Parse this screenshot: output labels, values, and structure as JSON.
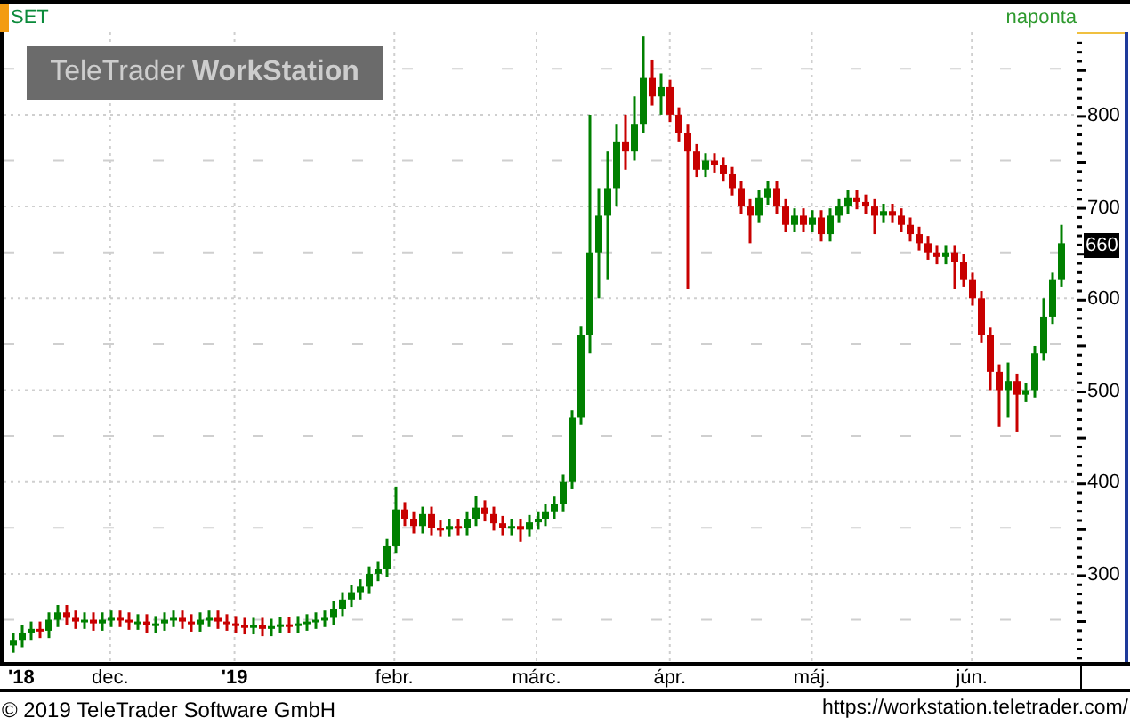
{
  "header": {
    "symbol": "SET",
    "interval": "naponta"
  },
  "logo": {
    "text_1": "TeleTrader",
    "text_2": "WorkStation"
  },
  "price_axis": {
    "current_price": "660"
  },
  "chart": {
    "chart_data": {
      "type": "candlestick",
      "grid": true,
      "ylim": [
        204,
        890
      ],
      "yticks": [
        300,
        400,
        500,
        600,
        700,
        800
      ],
      "categories": [
        null,
        "'18",
        null,
        null,
        null,
        null,
        null,
        null,
        null,
        null,
        null,
        "dec.",
        null,
        null,
        null,
        null,
        null,
        null,
        null,
        null,
        null,
        null,
        null,
        null,
        null,
        "'19",
        null,
        null,
        null,
        null,
        null,
        null,
        null,
        null,
        null,
        null,
        null,
        null,
        null,
        null,
        null,
        null,
        null,
        "febr.",
        null,
        null,
        null,
        null,
        null,
        null,
        null,
        null,
        null,
        null,
        null,
        null,
        null,
        null,
        null,
        "márc.",
        null,
        null,
        null,
        null,
        null,
        null,
        null,
        null,
        null,
        null,
        null,
        null,
        null,
        null,
        "ápr.",
        null,
        null,
        null,
        null,
        null,
        null,
        null,
        null,
        null,
        null,
        null,
        null,
        null,
        null,
        null,
        "máj.",
        null,
        null,
        null,
        null,
        null,
        null,
        null,
        null,
        null,
        null,
        null,
        null,
        null,
        null,
        null,
        null,
        null,
        "jún.",
        null,
        null,
        null,
        null,
        null,
        null,
        null,
        null,
        null,
        null
      ],
      "ohlc": [
        [
          222,
          236,
          214,
          228
        ],
        [
          228,
          244,
          220,
          236
        ],
        [
          236,
          248,
          228,
          240
        ],
        [
          240,
          248,
          230,
          238
        ],
        [
          238,
          258,
          230,
          250
        ],
        [
          250,
          266,
          242,
          258
        ],
        [
          258,
          266,
          244,
          252
        ],
        [
          252,
          260,
          240,
          248
        ],
        [
          248,
          258,
          240,
          250
        ],
        [
          250,
          258,
          238,
          246
        ],
        [
          246,
          258,
          238,
          250
        ],
        [
          250,
          260,
          242,
          252
        ],
        [
          252,
          260,
          242,
          250
        ],
        [
          250,
          258,
          239,
          247
        ],
        [
          247,
          256,
          239,
          248
        ],
        [
          248,
          256,
          236,
          244
        ],
        [
          244,
          254,
          236,
          246
        ],
        [
          246,
          258,
          238,
          250
        ],
        [
          250,
          260,
          242,
          252
        ],
        [
          252,
          260,
          240,
          248
        ],
        [
          248,
          256,
          237,
          245
        ],
        [
          245,
          258,
          237,
          250
        ],
        [
          250,
          260,
          242,
          252
        ],
        [
          252,
          260,
          240,
          248
        ],
        [
          248,
          256,
          238,
          246
        ],
        [
          246,
          254,
          236,
          244
        ],
        [
          244,
          252,
          234,
          242
        ],
        [
          242,
          252,
          234,
          244
        ],
        [
          244,
          252,
          232,
          240
        ],
        [
          240,
          251,
          232,
          243
        ],
        [
          243,
          253,
          235,
          245
        ],
        [
          245,
          253,
          236,
          244
        ],
        [
          244,
          254,
          236,
          246
        ],
        [
          246,
          256,
          238,
          248
        ],
        [
          248,
          258,
          240,
          250
        ],
        [
          250,
          260,
          242,
          252
        ],
        [
          252,
          270,
          244,
          262
        ],
        [
          262,
          280,
          254,
          272
        ],
        [
          272,
          288,
          264,
          280
        ],
        [
          280,
          294,
          272,
          286
        ],
        [
          286,
          308,
          278,
          300
        ],
        [
          300,
          313,
          292,
          305
        ],
        [
          305,
          338,
          297,
          330
        ],
        [
          330,
          395,
          322,
          370
        ],
        [
          370,
          378,
          352,
          360
        ],
        [
          360,
          368,
          344,
          352
        ],
        [
          352,
          373,
          344,
          365
        ],
        [
          365,
          373,
          342,
          350
        ],
        [
          350,
          358,
          340,
          348
        ],
        [
          348,
          360,
          340,
          352
        ],
        [
          352,
          360,
          342,
          350
        ],
        [
          350,
          368,
          342,
          360
        ],
        [
          360,
          385,
          352,
          372
        ],
        [
          372,
          380,
          357,
          365
        ],
        [
          365,
          373,
          347,
          355
        ],
        [
          355,
          363,
          342,
          350
        ],
        [
          350,
          360,
          342,
          352
        ],
        [
          352,
          360,
          335,
          348
        ],
        [
          348,
          364,
          340,
          356
        ],
        [
          356,
          368,
          348,
          360
        ],
        [
          360,
          376,
          352,
          368
        ],
        [
          368,
          384,
          360,
          376
        ],
        [
          376,
          408,
          368,
          400
        ],
        [
          400,
          478,
          392,
          470
        ],
        [
          470,
          570,
          462,
          560
        ],
        [
          560,
          800,
          540,
          650
        ],
        [
          650,
          720,
          600,
          690
        ],
        [
          690,
          760,
          620,
          720
        ],
        [
          720,
          790,
          700,
          770
        ],
        [
          770,
          800,
          740,
          760
        ],
        [
          760,
          820,
          750,
          790
        ],
        [
          790,
          885,
          780,
          840
        ],
        [
          840,
          860,
          810,
          820
        ],
        [
          820,
          845,
          800,
          830
        ],
        [
          830,
          838,
          792,
          800
        ],
        [
          800,
          808,
          770,
          780
        ],
        [
          780,
          790,
          610,
          760
        ],
        [
          760,
          768,
          732,
          740
        ],
        [
          740,
          758,
          732,
          750
        ],
        [
          750,
          758,
          737,
          745
        ],
        [
          745,
          753,
          727,
          735
        ],
        [
          735,
          743,
          712,
          720
        ],
        [
          720,
          728,
          692,
          700
        ],
        [
          700,
          708,
          660,
          690
        ],
        [
          690,
          718,
          682,
          710
        ],
        [
          710,
          728,
          702,
          720
        ],
        [
          720,
          728,
          692,
          700
        ],
        [
          700,
          708,
          672,
          680
        ],
        [
          680,
          698,
          672,
          690
        ],
        [
          690,
          698,
          672,
          680
        ],
        [
          680,
          696,
          672,
          688
        ],
        [
          688,
          696,
          662,
          670
        ],
        [
          670,
          698,
          662,
          690
        ],
        [
          690,
          708,
          682,
          700
        ],
        [
          700,
          718,
          692,
          710
        ],
        [
          710,
          718,
          697,
          705
        ],
        [
          705,
          713,
          692,
          700
        ],
        [
          700,
          708,
          670,
          690
        ],
        [
          690,
          703,
          682,
          695
        ],
        [
          695,
          703,
          682,
          690
        ],
        [
          690,
          698,
          672,
          680
        ],
        [
          680,
          688,
          662,
          670
        ],
        [
          670,
          678,
          652,
          660
        ],
        [
          660,
          668,
          642,
          650
        ],
        [
          650,
          658,
          637,
          645
        ],
        [
          645,
          658,
          637,
          650
        ],
        [
          650,
          658,
          610,
          640
        ],
        [
          640,
          648,
          612,
          620
        ],
        [
          620,
          628,
          592,
          600
        ],
        [
          600,
          608,
          552,
          560
        ],
        [
          560,
          568,
          500,
          520
        ],
        [
          520,
          528,
          460,
          500
        ],
        [
          500,
          530,
          470,
          510
        ],
        [
          510,
          518,
          455,
          495
        ],
        [
          495,
          508,
          487,
          500
        ],
        [
          500,
          548,
          492,
          540
        ],
        [
          540,
          600,
          532,
          580
        ],
        [
          580,
          628,
          572,
          620
        ],
        [
          620,
          680,
          612,
          660
        ]
      ]
    }
  },
  "footer": {
    "copyright": "© 2019 TeleTrader Software GmbH",
    "url": "https://workstation.teletrader.com/"
  }
}
